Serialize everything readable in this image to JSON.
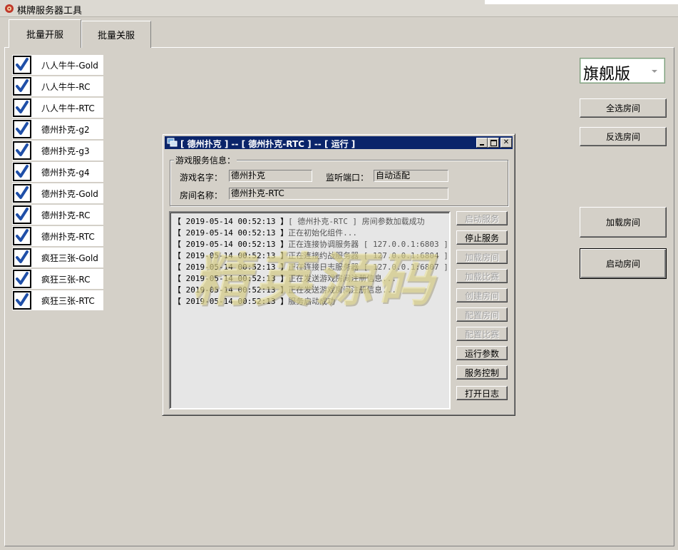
{
  "window": {
    "title": "棋牌服务器工具"
  },
  "tabs": [
    {
      "label": "批量开服"
    },
    {
      "label": "批量关服"
    }
  ],
  "games": [
    {
      "label": "八人牛牛-Gold",
      "checked": true
    },
    {
      "label": "八人牛牛-RC",
      "checked": true
    },
    {
      "label": "八人牛牛-RTC",
      "checked": true
    },
    {
      "label": "德州扑克-g2",
      "checked": true
    },
    {
      "label": "德州扑克-g3",
      "checked": true
    },
    {
      "label": "德州扑克-g4",
      "checked": true
    },
    {
      "label": "德州扑克-Gold",
      "checked": true
    },
    {
      "label": "德州扑克-RC",
      "checked": true
    },
    {
      "label": "德州扑克-RTC",
      "checked": true
    },
    {
      "label": "疯狂三张-Gold",
      "checked": true
    },
    {
      "label": "疯狂三张-RC",
      "checked": true
    },
    {
      "label": "疯狂三张-RTC",
      "checked": true
    }
  ],
  "edition": {
    "value": "旗舰版"
  },
  "right_buttons": {
    "select_all": "全选房间",
    "invert_select": "反选房间",
    "load_rooms": "加载房间",
    "start_rooms": "启动房间"
  },
  "dialog": {
    "title": "[ 德州扑克 ] -- [ 德州扑克-RTC ] -- [ 运行 ]",
    "group_title": "游戏服务信息：",
    "game_name_label": "游戏名字：",
    "game_name_value": "德州扑克",
    "port_label": "监听端口：",
    "port_value": "自动适配",
    "room_name_label": "房间名称：",
    "room_name_value": "德州扑克-RTC",
    "log": [
      {
        "time": "【 2019-05-14 00:52:13 】",
        "msg": "[ 德州扑克-RTC ] 房间参数加载成功"
      },
      {
        "time": "【 2019-05-14 00:52:13 】",
        "msg": "正在初始化组件..."
      },
      {
        "time": "【 2019-05-14 00:52:13 】",
        "msg": "正在连接协调服务器 [ 127.0.0.1:6803 ]"
      },
      {
        "time": "【 2019-05-14 00:52:13 】",
        "msg": "正在连接约战服务器 [ 127.0.0.1:6804 ]"
      },
      {
        "time": "【 2019-05-14 00:52:13 】",
        "msg": "正在连接日志服务器 [ 127.0.0.1:6807 ]"
      },
      {
        "time": "【 2019-05-14 00:52:13 】",
        "msg": "正在发送游戏房间注册信息..."
      },
      {
        "time": "【 2019-05-14 00:52:13 】",
        "msg": "正在发送游戏房间注册信息..."
      },
      {
        "time": "【 2019-05-14 00:52:13 】",
        "msg": "服务启动成功"
      }
    ],
    "buttons": [
      {
        "label": "启动服务",
        "enabled": false
      },
      {
        "label": "停止服务",
        "enabled": true
      },
      {
        "label": "加载房间",
        "enabled": false
      },
      {
        "label": "加载比赛",
        "enabled": false
      },
      {
        "label": "创建房间",
        "enabled": false
      },
      {
        "label": "配置房间",
        "enabled": false
      },
      {
        "label": "配置比赛",
        "enabled": false
      },
      {
        "label": "运行参数",
        "enabled": true
      },
      {
        "label": "服务控制",
        "enabled": true
      },
      {
        "label": "打开日志",
        "enabled": true
      }
    ]
  },
  "watermark": {
    "text": "精英源码"
  }
}
